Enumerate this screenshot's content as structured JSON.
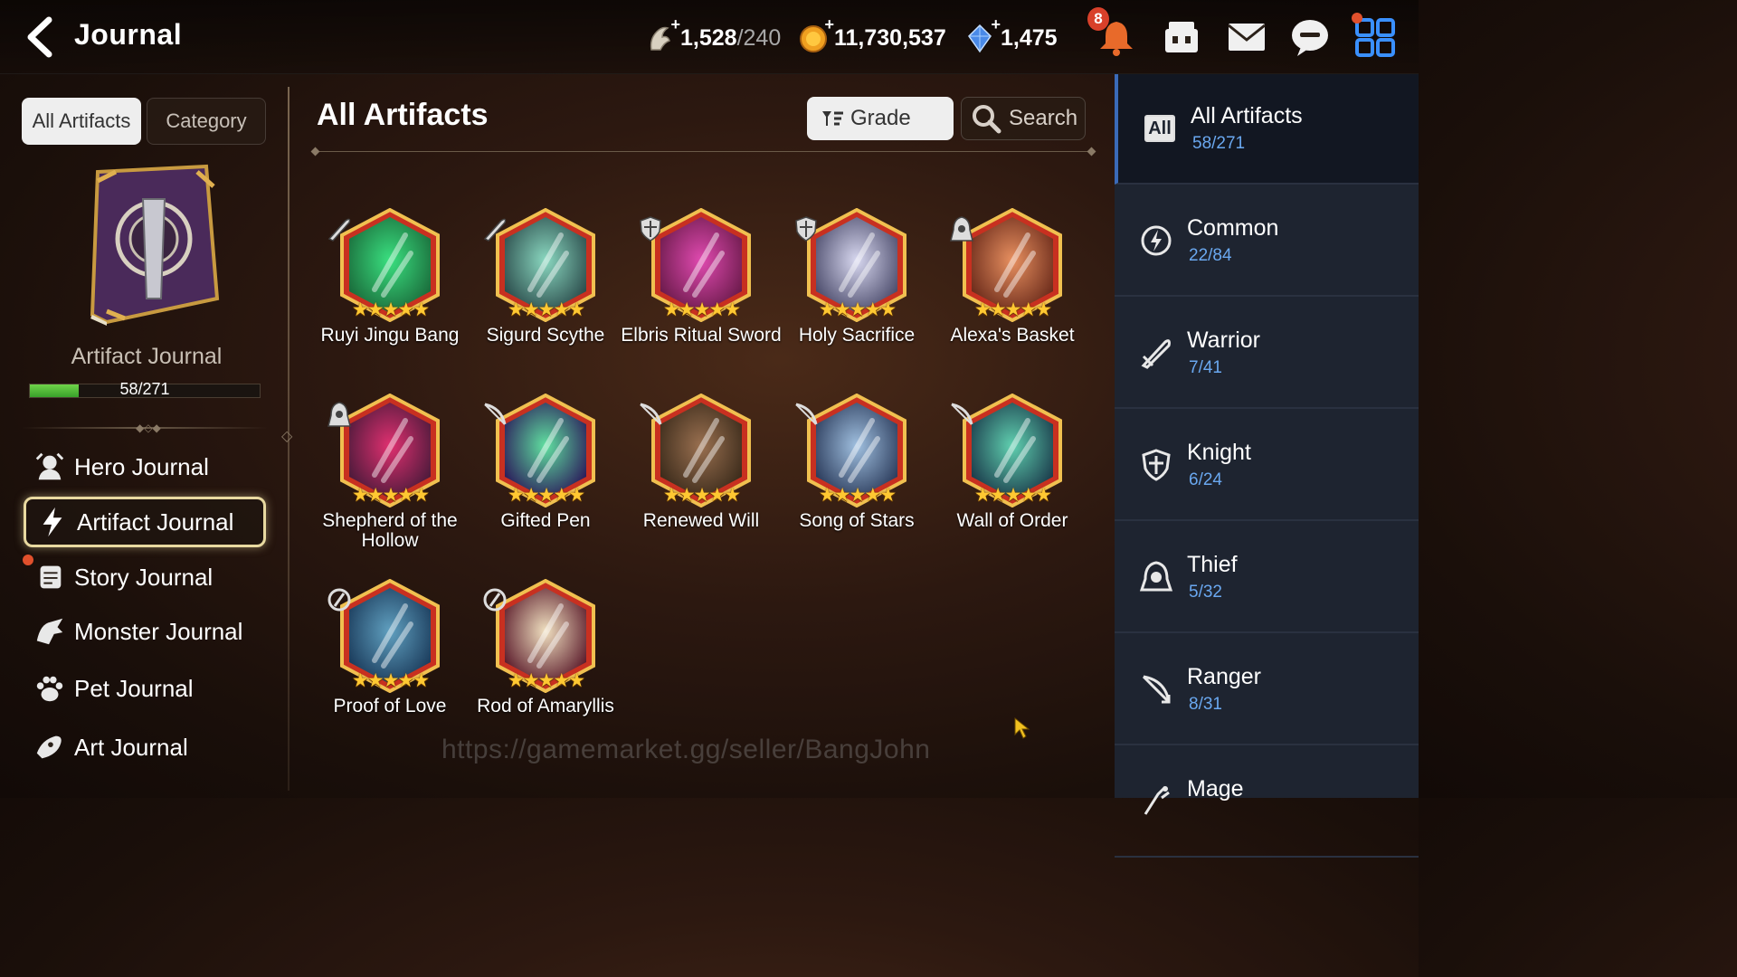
{
  "header": {
    "title": "Journal",
    "stamina": {
      "value": "1,528",
      "max": "/240"
    },
    "gold": "11,730,537",
    "crystals": "1,475",
    "notification_count": "8"
  },
  "sidebar": {
    "tabs": [
      "All Artifacts",
      "Category"
    ],
    "journal_name": "Artifact Journal",
    "progress_text": "58/271",
    "progress_fraction": 0.214,
    "nav": [
      {
        "label": "Hero Journal",
        "icon": "hero-icon"
      },
      {
        "label": "Artifact Journal",
        "icon": "lightning-icon"
      },
      {
        "label": "Story Journal",
        "icon": "scroll-icon"
      },
      {
        "label": "Monster Journal",
        "icon": "monster-icon"
      },
      {
        "label": "Pet Journal",
        "icon": "paw-icon"
      },
      {
        "label": "Art Journal",
        "icon": "brush-icon"
      }
    ]
  },
  "main": {
    "title": "All Artifacts",
    "grade_label": "Grade",
    "search_label": "Search",
    "artifacts": [
      {
        "name": "Ruyi Jingu Bang",
        "class": "warrior",
        "stars": "★★★★★"
      },
      {
        "name": "Sigurd Scythe",
        "class": "warrior",
        "stars": "★★★★★"
      },
      {
        "name": "Elbris Ritual Sword",
        "class": "knight",
        "stars": "★★★★★"
      },
      {
        "name": "Holy Sacrifice",
        "class": "knight",
        "stars": "★★★★★"
      },
      {
        "name": "Alexa's Basket",
        "class": "thief",
        "stars": "★★★★★"
      },
      {
        "name": "Shepherd of the Hollow",
        "class": "thief",
        "stars": "★★★★★"
      },
      {
        "name": "Gifted Pen",
        "class": "ranger",
        "stars": "★★★★★"
      },
      {
        "name": "Renewed Will",
        "class": "ranger",
        "stars": "★★★★★"
      },
      {
        "name": "Song of Stars",
        "class": "ranger",
        "stars": "★★★★★"
      },
      {
        "name": "Wall of Order",
        "class": "ranger",
        "stars": "★★★★★"
      },
      {
        "name": "Proof of Love",
        "class": "mage",
        "stars": "★★★★★"
      },
      {
        "name": "Rod of Amaryllis",
        "class": "mage",
        "stars": "★★★★★"
      }
    ],
    "watermark": "https://gamemarket.gg/seller/BangJohn"
  },
  "categories": [
    {
      "label": "All Artifacts",
      "count": "58/271",
      "icon_text": "All"
    },
    {
      "label": "Common",
      "count": "22/84",
      "icon": "common-icon"
    },
    {
      "label": "Warrior",
      "count": "7/41",
      "icon": "warrior-icon"
    },
    {
      "label": "Knight",
      "count": "6/24",
      "icon": "knight-icon"
    },
    {
      "label": "Thief",
      "count": "5/32",
      "icon": "thief-icon"
    },
    {
      "label": "Ranger",
      "count": "8/31",
      "icon": "ranger-icon"
    },
    {
      "label": "Mage",
      "count": "",
      "icon": "mage-icon"
    }
  ],
  "colors": {
    "accent_blue": "#6aa8f0",
    "star": "#ffc832",
    "progress": "#4cbf34",
    "badge": "#d8402a"
  }
}
